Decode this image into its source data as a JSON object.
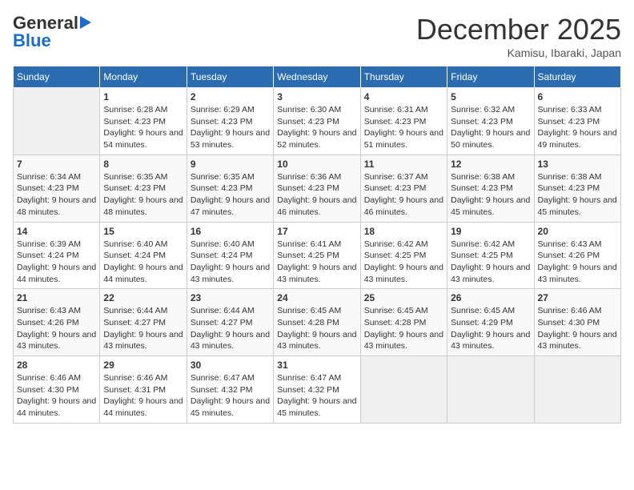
{
  "logo": {
    "general": "General",
    "blue": "Blue"
  },
  "title": "December 2025",
  "location": "Kamisu, Ibaraki, Japan",
  "days_of_week": [
    "Sunday",
    "Monday",
    "Tuesday",
    "Wednesday",
    "Thursday",
    "Friday",
    "Saturday"
  ],
  "weeks": [
    [
      {
        "day": "",
        "sunrise": "",
        "sunset": "",
        "daylight": ""
      },
      {
        "day": "1",
        "sunrise": "Sunrise: 6:28 AM",
        "sunset": "Sunset: 4:23 PM",
        "daylight": "Daylight: 9 hours and 54 minutes."
      },
      {
        "day": "2",
        "sunrise": "Sunrise: 6:29 AM",
        "sunset": "Sunset: 4:23 PM",
        "daylight": "Daylight: 9 hours and 53 minutes."
      },
      {
        "day": "3",
        "sunrise": "Sunrise: 6:30 AM",
        "sunset": "Sunset: 4:23 PM",
        "daylight": "Daylight: 9 hours and 52 minutes."
      },
      {
        "day": "4",
        "sunrise": "Sunrise: 6:31 AM",
        "sunset": "Sunset: 4:23 PM",
        "daylight": "Daylight: 9 hours and 51 minutes."
      },
      {
        "day": "5",
        "sunrise": "Sunrise: 6:32 AM",
        "sunset": "Sunset: 4:23 PM",
        "daylight": "Daylight: 9 hours and 50 minutes."
      },
      {
        "day": "6",
        "sunrise": "Sunrise: 6:33 AM",
        "sunset": "Sunset: 4:23 PM",
        "daylight": "Daylight: 9 hours and 49 minutes."
      }
    ],
    [
      {
        "day": "7",
        "sunrise": "Sunrise: 6:34 AM",
        "sunset": "Sunset: 4:23 PM",
        "daylight": "Daylight: 9 hours and 48 minutes."
      },
      {
        "day": "8",
        "sunrise": "Sunrise: 6:35 AM",
        "sunset": "Sunset: 4:23 PM",
        "daylight": "Daylight: 9 hours and 48 minutes."
      },
      {
        "day": "9",
        "sunrise": "Sunrise: 6:35 AM",
        "sunset": "Sunset: 4:23 PM",
        "daylight": "Daylight: 9 hours and 47 minutes."
      },
      {
        "day": "10",
        "sunrise": "Sunrise: 6:36 AM",
        "sunset": "Sunset: 4:23 PM",
        "daylight": "Daylight: 9 hours and 46 minutes."
      },
      {
        "day": "11",
        "sunrise": "Sunrise: 6:37 AM",
        "sunset": "Sunset: 4:23 PM",
        "daylight": "Daylight: 9 hours and 46 minutes."
      },
      {
        "day": "12",
        "sunrise": "Sunrise: 6:38 AM",
        "sunset": "Sunset: 4:23 PM",
        "daylight": "Daylight: 9 hours and 45 minutes."
      },
      {
        "day": "13",
        "sunrise": "Sunrise: 6:38 AM",
        "sunset": "Sunset: 4:23 PM",
        "daylight": "Daylight: 9 hours and 45 minutes."
      }
    ],
    [
      {
        "day": "14",
        "sunrise": "Sunrise: 6:39 AM",
        "sunset": "Sunset: 4:24 PM",
        "daylight": "Daylight: 9 hours and 44 minutes."
      },
      {
        "day": "15",
        "sunrise": "Sunrise: 6:40 AM",
        "sunset": "Sunset: 4:24 PM",
        "daylight": "Daylight: 9 hours and 44 minutes."
      },
      {
        "day": "16",
        "sunrise": "Sunrise: 6:40 AM",
        "sunset": "Sunset: 4:24 PM",
        "daylight": "Daylight: 9 hours and 43 minutes."
      },
      {
        "day": "17",
        "sunrise": "Sunrise: 6:41 AM",
        "sunset": "Sunset: 4:25 PM",
        "daylight": "Daylight: 9 hours and 43 minutes."
      },
      {
        "day": "18",
        "sunrise": "Sunrise: 6:42 AM",
        "sunset": "Sunset: 4:25 PM",
        "daylight": "Daylight: 9 hours and 43 minutes."
      },
      {
        "day": "19",
        "sunrise": "Sunrise: 6:42 AM",
        "sunset": "Sunset: 4:25 PM",
        "daylight": "Daylight: 9 hours and 43 minutes."
      },
      {
        "day": "20",
        "sunrise": "Sunrise: 6:43 AM",
        "sunset": "Sunset: 4:26 PM",
        "daylight": "Daylight: 9 hours and 43 minutes."
      }
    ],
    [
      {
        "day": "21",
        "sunrise": "Sunrise: 6:43 AM",
        "sunset": "Sunset: 4:26 PM",
        "daylight": "Daylight: 9 hours and 43 minutes."
      },
      {
        "day": "22",
        "sunrise": "Sunrise: 6:44 AM",
        "sunset": "Sunset: 4:27 PM",
        "daylight": "Daylight: 9 hours and 43 minutes."
      },
      {
        "day": "23",
        "sunrise": "Sunrise: 6:44 AM",
        "sunset": "Sunset: 4:27 PM",
        "daylight": "Daylight: 9 hours and 43 minutes."
      },
      {
        "day": "24",
        "sunrise": "Sunrise: 6:45 AM",
        "sunset": "Sunset: 4:28 PM",
        "daylight": "Daylight: 9 hours and 43 minutes."
      },
      {
        "day": "25",
        "sunrise": "Sunrise: 6:45 AM",
        "sunset": "Sunset: 4:28 PM",
        "daylight": "Daylight: 9 hours and 43 minutes."
      },
      {
        "day": "26",
        "sunrise": "Sunrise: 6:45 AM",
        "sunset": "Sunset: 4:29 PM",
        "daylight": "Daylight: 9 hours and 43 minutes."
      },
      {
        "day": "27",
        "sunrise": "Sunrise: 6:46 AM",
        "sunset": "Sunset: 4:30 PM",
        "daylight": "Daylight: 9 hours and 43 minutes."
      }
    ],
    [
      {
        "day": "28",
        "sunrise": "Sunrise: 6:46 AM",
        "sunset": "Sunset: 4:30 PM",
        "daylight": "Daylight: 9 hours and 44 minutes."
      },
      {
        "day": "29",
        "sunrise": "Sunrise: 6:46 AM",
        "sunset": "Sunset: 4:31 PM",
        "daylight": "Daylight: 9 hours and 44 minutes."
      },
      {
        "day": "30",
        "sunrise": "Sunrise: 6:47 AM",
        "sunset": "Sunset: 4:32 PM",
        "daylight": "Daylight: 9 hours and 45 minutes."
      },
      {
        "day": "31",
        "sunrise": "Sunrise: 6:47 AM",
        "sunset": "Sunset: 4:32 PM",
        "daylight": "Daylight: 9 hours and 45 minutes."
      },
      {
        "day": "",
        "sunrise": "",
        "sunset": "",
        "daylight": ""
      },
      {
        "day": "",
        "sunrise": "",
        "sunset": "",
        "daylight": ""
      },
      {
        "day": "",
        "sunrise": "",
        "sunset": "",
        "daylight": ""
      }
    ]
  ]
}
